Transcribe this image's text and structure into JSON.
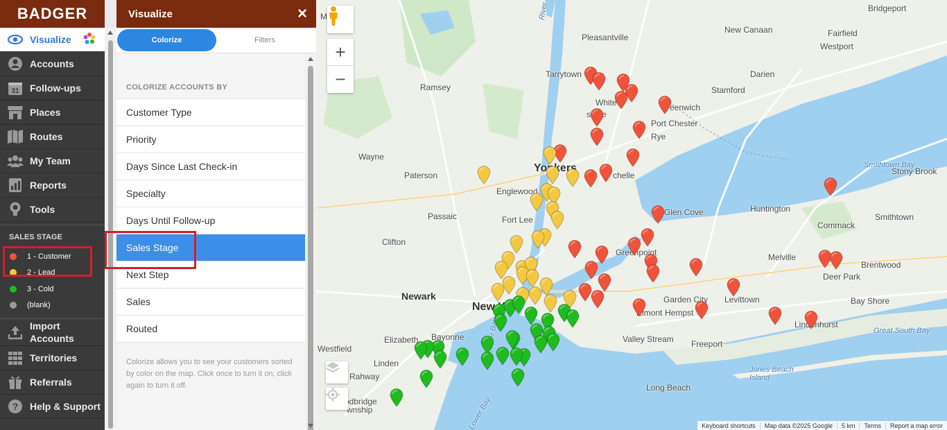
{
  "app": {
    "logo": "BADGER"
  },
  "nav": {
    "items": [
      {
        "label": "Visualize",
        "icon": "eye-icon",
        "active": true
      },
      {
        "label": "Accounts",
        "icon": "person-icon"
      },
      {
        "label": "Follow-ups",
        "icon": "calendar-icon",
        "icon_text": "31"
      },
      {
        "label": "Places",
        "icon": "store-icon"
      },
      {
        "label": "Routes",
        "icon": "map-icon"
      },
      {
        "label": "My Team",
        "icon": "team-icon"
      },
      {
        "label": "Reports",
        "icon": "report-icon"
      },
      {
        "label": "Tools",
        "icon": "bulb-icon"
      }
    ],
    "section_title": "SALES STAGE",
    "legend": [
      {
        "label": "1 - Customer",
        "color": "#f0533a"
      },
      {
        "label": "2 - Lead",
        "color": "#f5c842"
      },
      {
        "label": "3 - Cold",
        "color": "#1fbb1f"
      },
      {
        "label": "(blank)",
        "color": "#9a9a9a"
      }
    ],
    "bottom_items": [
      {
        "label_line1": "Import",
        "label_line2": "Accounts",
        "icon": "upload-icon"
      },
      {
        "label": "Territories",
        "icon": "grid-icon"
      },
      {
        "label": "Referrals",
        "icon": "gift-icon"
      },
      {
        "label": "Help & Support",
        "icon": "help-icon"
      }
    ]
  },
  "panel": {
    "title": "Visualize",
    "tabs": {
      "colorize": "Colorize",
      "filters": "Filters"
    },
    "section_title": "COLORIZE ACCOUNTS BY",
    "options": [
      "Customer Type",
      "Priority",
      "Days Since Last Check-in",
      "Specialty",
      "Days Until Follow-up",
      "Sales Stage",
      "Next Step",
      "Sales",
      "Routed"
    ],
    "selected_option": "Sales Stage",
    "help_text": "Colorize allows you to see your customers sorted by color on the map. Click once to turn it on, click again to turn it off."
  },
  "map": {
    "zoom_in": "+",
    "zoom_out": "−",
    "labels": [
      {
        "text": "Bridgeport"
      },
      {
        "text": "Pleasantville"
      },
      {
        "text": "New Canaan"
      },
      {
        "text": "Fairfield"
      },
      {
        "text": "Westport"
      },
      {
        "text": "Mahwah"
      },
      {
        "text": "Tarrytown"
      },
      {
        "text": "Darien"
      },
      {
        "text": "Ramsey"
      },
      {
        "text": "Stamford"
      },
      {
        "text": "White"
      },
      {
        "text": "eenwich"
      },
      {
        "text": "sdale"
      },
      {
        "text": "Port Chester"
      },
      {
        "text": "Rye"
      },
      {
        "text": "Wayne"
      },
      {
        "text": "Yonkers"
      },
      {
        "text": "Paterson"
      },
      {
        "text": "Englewood"
      },
      {
        "text": "chelle"
      },
      {
        "text": "Smithtown Bay"
      },
      {
        "text": "Stony Brook"
      },
      {
        "text": "Huntington"
      },
      {
        "text": "Glen Cove"
      },
      {
        "text": "Fort Lee"
      },
      {
        "text": "Passaic"
      },
      {
        "text": "Commack"
      },
      {
        "text": "Smithtown"
      },
      {
        "text": "Clifton"
      },
      {
        "text": "Melville"
      },
      {
        "text": "Brentwood"
      },
      {
        "text": "Deer Park"
      },
      {
        "text": "Newark"
      },
      {
        "text": "New York"
      },
      {
        "text": "Garden City"
      },
      {
        "text": "Levittown"
      },
      {
        "text": "Bay Shore"
      },
      {
        "text": "Hempst"
      },
      {
        "text": "Lindenhurst"
      },
      {
        "text": "Elizabeth"
      },
      {
        "text": "Bayonne"
      },
      {
        "text": "Valley Stream"
      },
      {
        "text": "Freeport"
      },
      {
        "text": "Great South Bay"
      },
      {
        "text": "Westfield"
      },
      {
        "text": "Linden"
      },
      {
        "text": "Rahway"
      },
      {
        "text": "Jones Beach Island"
      },
      {
        "text": "Long Beach"
      },
      {
        "text": "odbridge"
      },
      {
        "text": "wnship"
      },
      {
        "text": "Elmont"
      },
      {
        "text": "Greenpoint"
      },
      {
        "text": "Upper Bay"
      },
      {
        "text": "Lower Bay"
      },
      {
        "text": "River"
      }
    ],
    "attribution": [
      "Keyboard shortcuts",
      "Map data ©2025 Google",
      "5 km",
      "Terms",
      "Report a map error"
    ],
    "colors": {
      "customer": "#f0533a",
      "lead": "#f5c842",
      "cold": "#1fbb1f"
    }
  }
}
